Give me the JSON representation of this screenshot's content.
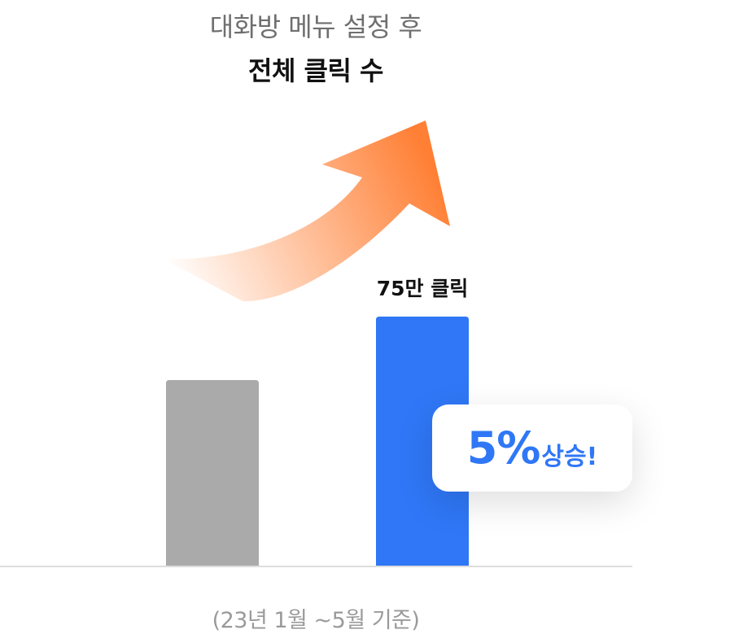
{
  "header": {
    "subtitle": "대화방 메뉴 설정 후",
    "title": "전체 클릭 수"
  },
  "chart_data": {
    "type": "bar",
    "categories": [
      "",
      ""
    ],
    "values": [
      56,
      75
    ],
    "value_labels": [
      "",
      "75만 클릭"
    ],
    "bar_colors": [
      "#aaaaaa",
      "#2f77f6"
    ],
    "ylim": [
      0,
      100
    ],
    "grid": false,
    "legend": "none"
  },
  "badge": {
    "percent": "5%",
    "text": "상승!"
  },
  "footnote": "(23년 1월 ~5월 기준)",
  "colors": {
    "accent": "#2f77f6",
    "arrow": "#ff7f34",
    "baseline": "#dddddd"
  }
}
